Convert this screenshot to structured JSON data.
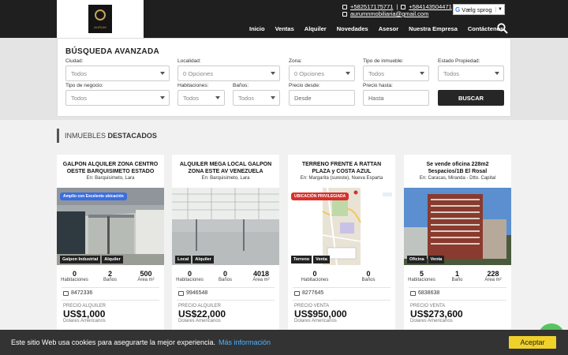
{
  "header": {
    "logo_text": "AURUM",
    "phone1": "+582517175771",
    "phone2": "+584143504471",
    "email": "aurumnmobiliaria@gmail.com",
    "separator": "|",
    "language_label": "Vælg sprog",
    "nav": [
      "Inicio",
      "Ventas",
      "Alquiler",
      "Novedades",
      "Asesor",
      "Nuestra Empresa",
      "Contáctenos"
    ]
  },
  "search": {
    "title": "BÚSQUEDA AVANZADA",
    "ciudad": {
      "label": "Ciudad:",
      "value": "Todos"
    },
    "localidad": {
      "label": "Localidad:",
      "value": "0 Opciones"
    },
    "zona": {
      "label": "Zona:",
      "value": "0 Opciones"
    },
    "tipo_inmueble": {
      "label": "Tipo de inmueble:",
      "value": "Todos"
    },
    "estado": {
      "label": "Estado Propiedad:",
      "value": "Todos"
    },
    "negocio": {
      "label": "Tipo de negocio:",
      "value": "Todos"
    },
    "habitaciones": {
      "label": "Habitaciones:",
      "value": "Todos"
    },
    "banos": {
      "label": "Baños:",
      "value": "Todos"
    },
    "precio_desde": {
      "label": "Precio desde:",
      "placeholder": "Desde"
    },
    "precio_hasta": {
      "label": "Precio hasta:",
      "placeholder": "Hasta"
    },
    "button": "BUSCAR"
  },
  "section": {
    "prefix": "INMUEBLES",
    "bold": "DESTACADOS"
  },
  "cards": [
    {
      "title": "GALPON ALQUILER ZONA CENTRO OESTE BARQUISIMETO ESTADO",
      "location": "En: Barquisimeto, Lara",
      "ribbon": "Amplio con Excelente ubicación",
      "ribbon_color": "#3a6de0",
      "tags": [
        "Galpon Industrial",
        "Alquiler"
      ],
      "stats": [
        {
          "num": "0",
          "lbl": "Habitaciones"
        },
        {
          "num": "2",
          "lbl": "Baños"
        },
        {
          "num": "500",
          "lbl": "Área m²"
        }
      ],
      "code": "8472336",
      "price_type": "PRECIO ALQUILER",
      "price": "US$1,000",
      "currency": "Dolares Americanos"
    },
    {
      "title": "ALQUILER MEGA LOCAL GALPON ZONA ESTE AV VENEZUELA",
      "location": "En: Barquisimeto, Lara",
      "ribbon": "",
      "ribbon_color": "",
      "tags": [
        "Local",
        "Alquiler"
      ],
      "stats": [
        {
          "num": "0",
          "lbl": "Habitaciones"
        },
        {
          "num": "0",
          "lbl": "Baños"
        },
        {
          "num": "4018",
          "lbl": "Área m²"
        }
      ],
      "code": "9946548",
      "price_type": "PRECIO ALQUILER",
      "price": "US$22,000",
      "currency": "Dolares Americanos"
    },
    {
      "title": "TERRENO FRENTE A RATTAN PLAZA y COSTA AZUL",
      "location": "En: Margarita (sureste), Nueva Esparta",
      "ribbon": "UBICACIÓN PRIVILEGIADA",
      "ribbon_color": "#d9302a",
      "tags": [
        "Terreno",
        "Venta"
      ],
      "stats": [
        {
          "num": "0",
          "lbl": "Habitaciones"
        },
        {
          "num": "0",
          "lbl": "Baños"
        }
      ],
      "code": "8277645",
      "price_type": "PRECIO VENTA",
      "price": "US$950,000",
      "currency": "Dolares Americanos"
    },
    {
      "title": "Se vende oficina 228m2 5espacios/1B El Rosal",
      "location": "En: Caracas, Miranda - Dtto. Capital",
      "ribbon": "",
      "ribbon_color": "",
      "tags": [
        "Oficina",
        "Venta"
      ],
      "stats": [
        {
          "num": "5",
          "lbl": "Habitaciones"
        },
        {
          "num": "1",
          "lbl": "Baño"
        },
        {
          "num": "228",
          "lbl": "Área m²"
        }
      ],
      "code": "6838638",
      "price_type": "PRECIO VENTA",
      "price": "US$273,600",
      "currency": "Dolares Americanos"
    }
  ],
  "cookie": {
    "text": "Este sitio Web usa cookies para asegurarte la mejor experiencia.",
    "more": "Más información",
    "accept": "Aceptar"
  }
}
